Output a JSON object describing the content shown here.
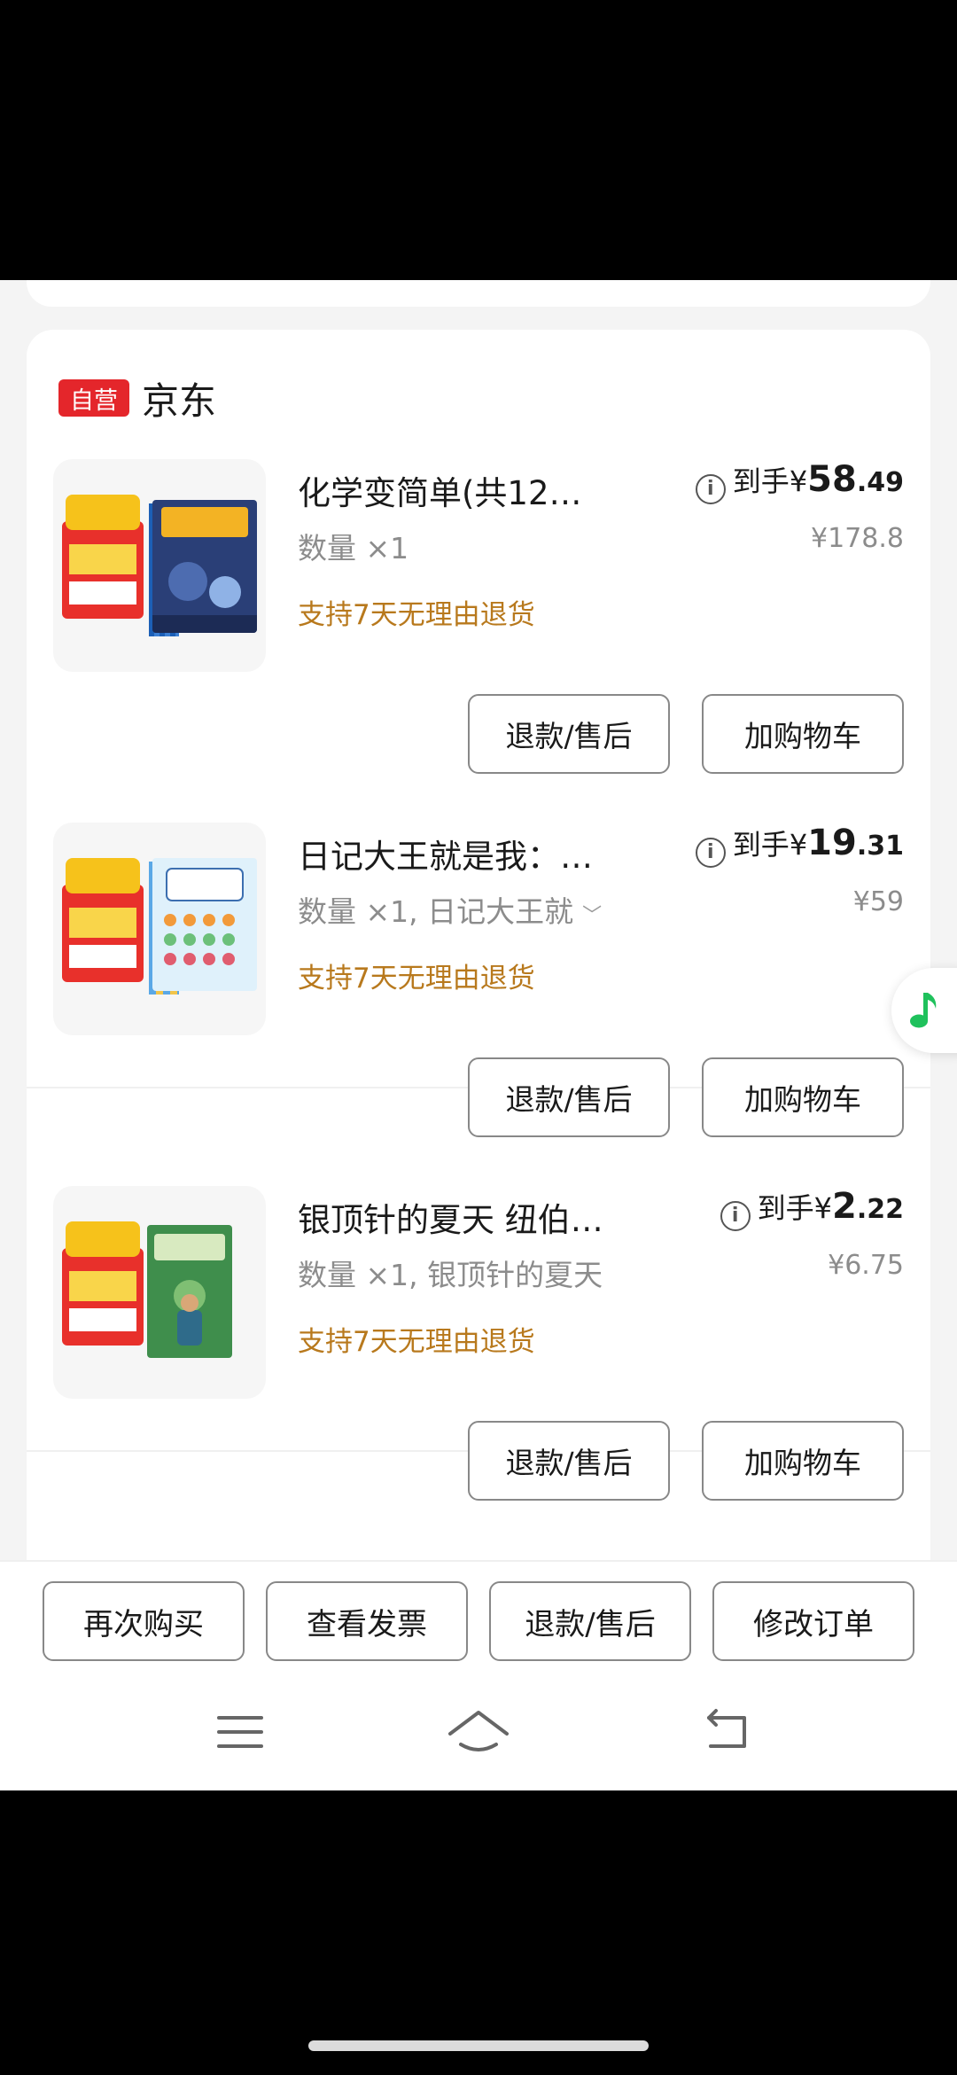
{
  "shop": {
    "badge": "自营",
    "name": "京东"
  },
  "items": [
    {
      "title": "化学变简单(共12…",
      "quantity": "数量 ×1",
      "policy": "支持7天无理由退货",
      "price_label": "到手",
      "price_currency": "¥",
      "price_int": "58",
      "price_dec": ".49",
      "original_price": "¥178.8",
      "refund_label": "退款/售后",
      "add_cart_label": "加购物车"
    },
    {
      "title": "日记大王就是我：…",
      "quantity": "数量 ×1, 日记大王就",
      "policy": "支持7天无理由退货",
      "price_label": "到手",
      "price_currency": "¥",
      "price_int": "19",
      "price_dec": ".31",
      "original_price": "¥59",
      "refund_label": "退款/售后",
      "add_cart_label": "加购物车"
    },
    {
      "title": "银顶针的夏天 纽伯…",
      "quantity": "数量 ×1, 银顶针的夏天",
      "policy": "支持7天无理由退货",
      "price_label": "到手",
      "price_currency": "¥",
      "price_int": "2",
      "price_dec": ".22",
      "original_price": "¥6.75",
      "refund_label": "退款/售后",
      "add_cart_label": "加购物车"
    }
  ],
  "bottom_bar": {
    "buy_again": "再次购买",
    "view_invoice": "查看发票",
    "refund": "退款/售后",
    "modify_order": "修改订单"
  },
  "colors": {
    "accent_red": "#e4262b",
    "policy_orange": "#b8791d",
    "music_green": "#1fc15c"
  },
  "icons": [
    "info-icon",
    "music-note-icon",
    "menu-icon",
    "home-icon",
    "back-icon",
    "chevron-down-icon"
  ]
}
